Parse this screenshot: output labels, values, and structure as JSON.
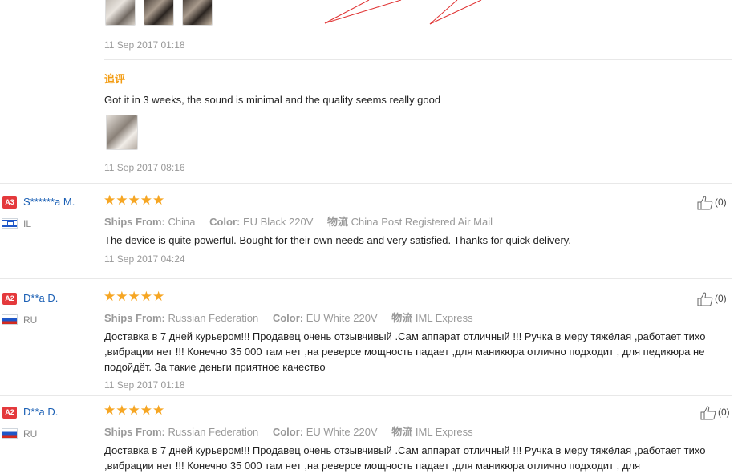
{
  "top_review": {
    "date": "11 Sep 2017 01:18",
    "additional": {
      "title": "追评",
      "text": "Got it in 3 weeks, the sound is minimal and the quality seems really good",
      "date": "11 Sep 2017 08:16"
    }
  },
  "labels": {
    "ships_from": "Ships From:",
    "color": "Color:",
    "logistics": "物流"
  },
  "reviews": [
    {
      "level": "A3",
      "user": "S******a M.",
      "country": "IL",
      "stars": "★★★★★",
      "ships_from": "China",
      "color": "EU Black 220V",
      "logistics": "China Post Registered Air Mail",
      "text": "The device is quite powerful. Bought for their own needs and very satisfied. Thanks for quick delivery.",
      "date": "11 Sep 2017 04:24",
      "helpful": "(0)"
    },
    {
      "level": "A2",
      "user": "D**a D.",
      "country": "RU",
      "stars": "★★★★★",
      "ships_from": "Russian Federation",
      "color": "EU White 220V",
      "logistics": "IML Express",
      "text": "Доставка в 7 дней курьером!!! Продавец очень отзывчивый .Сам аппарат отличный !!! Ручка в меру тяжёлая ,работает тихо ,вибрации нет !!! Конечно 35 000 там нет ,на реверсе мощность падает ,для маникюра отлично подходит , для педикюра не подойдёт. За такие деньги приятное качество",
      "date": "11 Sep 2017 01:18",
      "helpful": "(0)"
    },
    {
      "level": "A2",
      "user": "D**a D.",
      "country": "RU",
      "stars": "★★★★★",
      "ships_from": "Russian Federation",
      "color": "EU White 220V",
      "logistics": "IML Express",
      "text": "Доставка в 7 дней курьером!!! Продавец очень отзывчивый .Сам аппарат отличный !!! Ручка в меру тяжёлая ,работает тихо ,вибрации нет !!! Конечно 35 000 там нет ,на реверсе мощность падает ,для маникюра отлично подходит , для",
      "date": "",
      "helpful": "(0)"
    }
  ]
}
